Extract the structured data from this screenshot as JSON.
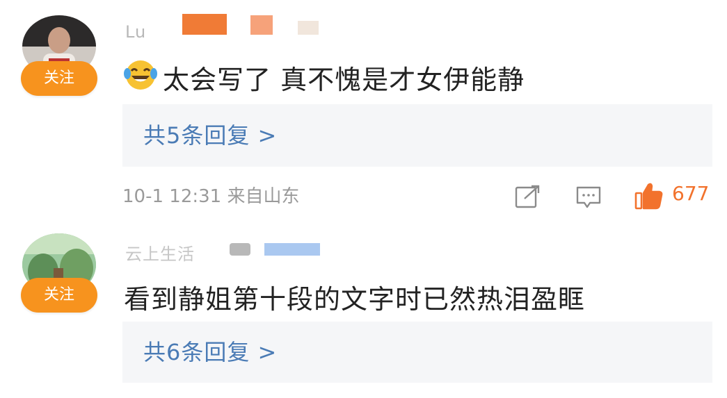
{
  "comments": [
    {
      "username": "Lu",
      "follow_label": "关注",
      "text": "太会写了 真不愧是才女伊能静",
      "emoji": "laughing-tears-emoji",
      "replies_label": "共5条回复 >",
      "meta": "10-1 12:31 来自山东",
      "likes": "677"
    },
    {
      "username": "云上生活",
      "follow_label": "关注",
      "text": "看到静姐第十段的文字时已然热泪盈眶",
      "replies_label": "共6条回复 >"
    }
  ],
  "colors": {
    "follow": "#f7931e",
    "link": "#4a7bb5",
    "like": "#f2722c",
    "reply_bg": "#f5f6f8"
  },
  "icons": [
    "share-icon",
    "comment-icon",
    "like-icon"
  ]
}
